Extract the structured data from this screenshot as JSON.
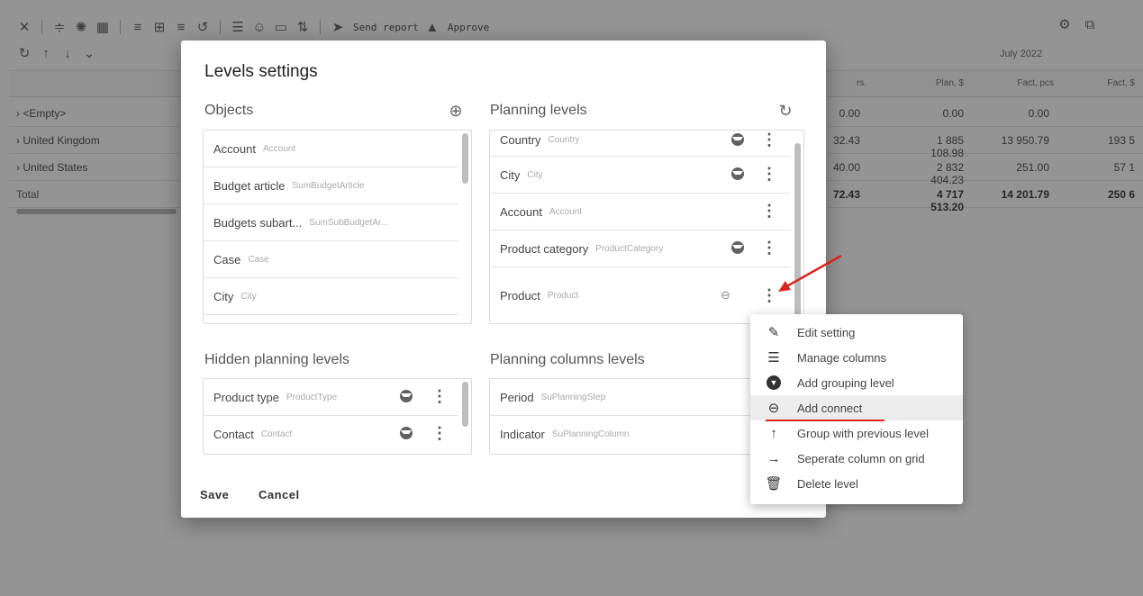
{
  "toolbar": {
    "send_report": "Send report",
    "approve": "Approve"
  },
  "grid": {
    "month": "July 2022",
    "headers": [
      "rs.",
      "Plan, $",
      "Fact, pcs",
      "Fact, $"
    ],
    "rows": [
      {
        "label": "<Empty>",
        "v1": "0.00",
        "v2": "0.00",
        "v3": "0.00",
        "v4": ""
      },
      {
        "label": "United Kingdom",
        "v1": "32.43",
        "v2": "1 885 108.98",
        "v3": "13 950.79",
        "v4": "193 5"
      },
      {
        "label": "United States",
        "v1": "40.00",
        "v2": "2 832 404.23",
        "v3": "251.00",
        "v4": "57 1"
      }
    ],
    "total": {
      "label": "Total",
      "v1": "72.43",
      "v2": "4 717 513.20",
      "v3": "14 201.79",
      "v4": "250 6"
    }
  },
  "dialog": {
    "title": "Levels settings",
    "objects": {
      "title": "Objects",
      "items": [
        {
          "name": "Account",
          "sub": "Account"
        },
        {
          "name": "Budget article",
          "sub": "SumBudgetArticle"
        },
        {
          "name": "Budgets subart...",
          "sub": "SumSubBudgetAr..."
        },
        {
          "name": "Case",
          "sub": "Case"
        },
        {
          "name": "City",
          "sub": "City"
        }
      ]
    },
    "planning_levels": {
      "title": "Planning levels",
      "items": [
        {
          "name": "Country",
          "sub": "Country"
        },
        {
          "name": "City",
          "sub": "City"
        },
        {
          "name": "Account",
          "sub": "Account"
        },
        {
          "name": "Product category",
          "sub": "ProductCategory"
        },
        {
          "name": "Product",
          "sub": "Product"
        }
      ]
    },
    "hidden_levels": {
      "title": "Hidden planning levels",
      "items": [
        {
          "name": "Product type",
          "sub": "ProductType"
        },
        {
          "name": "Contact",
          "sub": "Contact"
        }
      ]
    },
    "columns_levels": {
      "title": "Planning columns levels",
      "items": [
        {
          "name": "Period",
          "sub": "SuPlanningStep"
        },
        {
          "name": "Indicator",
          "sub": "SuPlanningColumn"
        }
      ]
    },
    "save": "Save",
    "cancel": "Cancel"
  },
  "menu": {
    "items": [
      {
        "label": "Edit setting",
        "icon": "pencil-icon"
      },
      {
        "label": "Manage columns",
        "icon": "list-icon"
      },
      {
        "label": "Add grouping level",
        "icon": "circle-chevron-down-icon"
      },
      {
        "label": "Add connect",
        "icon": "link-icon"
      },
      {
        "label": "Group with previous level",
        "icon": "arrow-up-icon"
      },
      {
        "label": "Seperate column on grid",
        "icon": "arrow-right-icon"
      },
      {
        "label": "Delete level",
        "icon": "trash-icon"
      }
    ]
  },
  "colors": {
    "accent_red": "#d9241c",
    "overlay": "rgba(0,0,0,0.42)"
  }
}
